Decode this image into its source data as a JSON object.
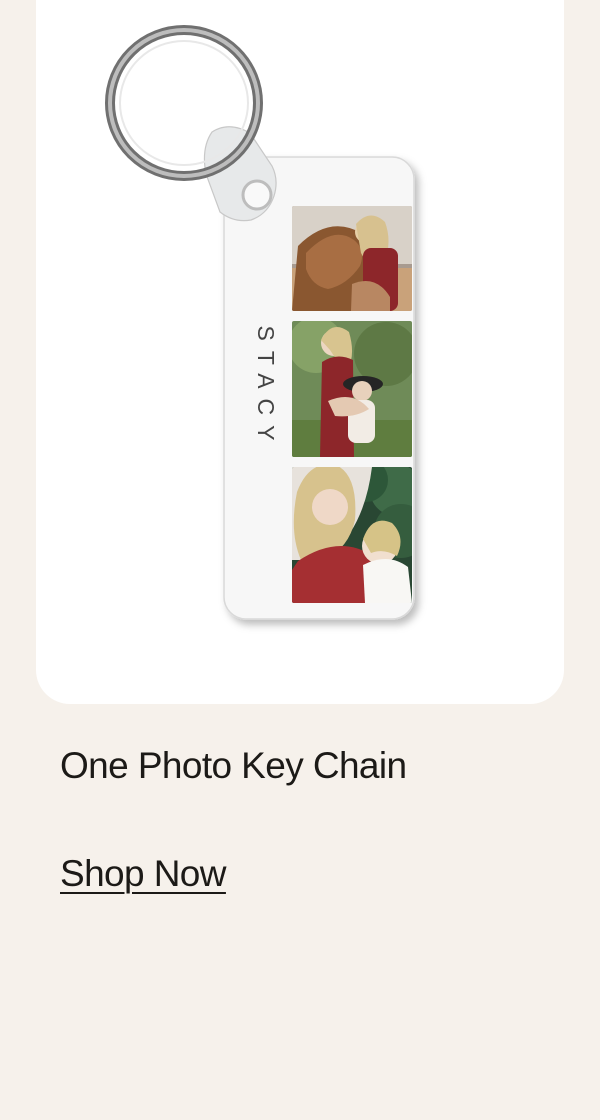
{
  "product": {
    "name": "One Photo Key Chain",
    "engraving": "STACY",
    "cta_label": "Shop Now"
  },
  "colors": {
    "page_background": "#f6f1eb",
    "card_background": "#ffffff",
    "text": "#1c1a17",
    "accent_dress": "#8f2a2c"
  },
  "icons": {
    "key_ring": "keyring-icon"
  }
}
